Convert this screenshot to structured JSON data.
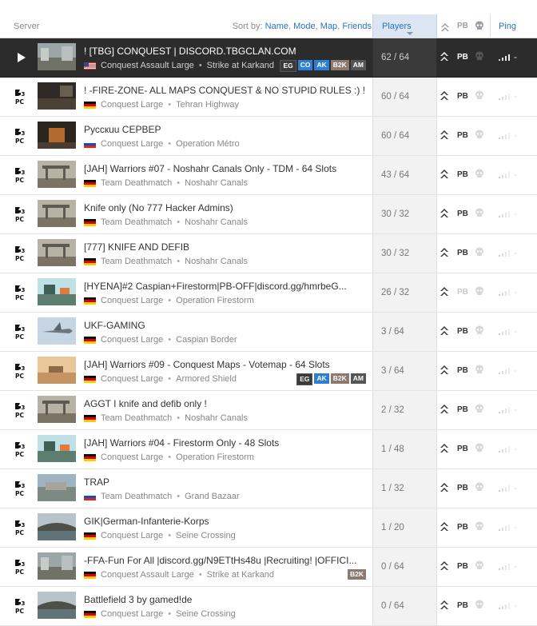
{
  "header": {
    "server_label": "Server",
    "sort_by_label": "Sort by:",
    "sort_options": [
      "Name",
      "Mode",
      "Map",
      "Friends"
    ],
    "players_label": "Players",
    "pb_label": "PB",
    "ping_label": "Ping"
  },
  "rows": [
    {
      "name": "! [TBG] CONQUEST | DISCORD.TBGCLAN.COM",
      "flag": "us",
      "mode": "Conquest Assault Large",
      "map": "Strike at Karkand",
      "players": "62 / 64",
      "tags": [
        "EG",
        "CO",
        "AK",
        "B2K",
        "AM"
      ],
      "pb": true,
      "selected": true,
      "thumb": "city"
    },
    {
      "name": "! -FIRE-ZONE- ALL MAPS CONQUEST & NO STUPID RULES :) !",
      "flag": "de",
      "mode": "Conquest Large",
      "map": "Tehran Highway",
      "players": "60 / 64",
      "tags": [],
      "pb": true,
      "selected": false,
      "thumb": "dark"
    },
    {
      "name": "Русскuu CEPBEP",
      "flag": "ru",
      "mode": "Conquest Large",
      "map": "Operation Métro",
      "players": "60 / 64",
      "tags": [],
      "pb": true,
      "selected": false,
      "thumb": "metro"
    },
    {
      "name": "[JAH] Warriors #07 - Noshahr Canals Only - TDM - 64 Slots",
      "flag": "de",
      "mode": "Team Deathmatch",
      "map": "Noshahr Canals",
      "players": "43 / 64",
      "tags": [],
      "pb": true,
      "selected": false,
      "thumb": "canals"
    },
    {
      "name": "Knife only (No 777 Hacker Admins)",
      "flag": "de",
      "mode": "Team Deathmatch",
      "map": "Noshahr Canals",
      "players": "30 / 32",
      "tags": [],
      "pb": true,
      "selected": false,
      "thumb": "canals"
    },
    {
      "name": "[777] KNIFE AND DEFIB",
      "flag": "de",
      "mode": "Team Deathmatch",
      "map": "Noshahr Canals",
      "players": "30 / 32",
      "tags": [],
      "pb": true,
      "selected": false,
      "thumb": "canals"
    },
    {
      "name": "[HYENA]#2 Caspian+Firestorm|PB-OFF|discord.gg/hmrbeG...",
      "flag": "de",
      "mode": "Conquest Large",
      "map": "Operation Firestorm",
      "players": "26 / 32",
      "tags": [],
      "pb": false,
      "selected": false,
      "thumb": "firestorm"
    },
    {
      "name": "UKF-GAMING",
      "flag": "de",
      "mode": "Conquest Large",
      "map": "Caspian Border",
      "players": "3 / 64",
      "tags": [],
      "pb": true,
      "selected": false,
      "thumb": "jet"
    },
    {
      "name": "[JAH] Warriors #09 - Conquest Maps - Votemap - 64 Slots",
      "flag": "de",
      "mode": "Conquest Large",
      "map": "Armored Shield",
      "players": "3 / 64",
      "tags": [
        "EG",
        "AK",
        "B2K",
        "AM"
      ],
      "pb": true,
      "selected": false,
      "thumb": "desert"
    },
    {
      "name": "AGGT I knife and defib only !",
      "flag": "de",
      "mode": "Team Deathmatch",
      "map": "Noshahr Canals",
      "players": "2 / 32",
      "tags": [],
      "pb": true,
      "selected": false,
      "thumb": "canals"
    },
    {
      "name": "[JAH] Warriors #04 - Firestorm Only - 48 Slots",
      "flag": "de",
      "mode": "Conquest Large",
      "map": "Operation Firestorm",
      "players": "1 / 48",
      "tags": [],
      "pb": true,
      "selected": false,
      "thumb": "firestorm"
    },
    {
      "name": "TRAP",
      "flag": "ru",
      "mode": "Team Deathmatch",
      "map": "Grand Bazaar",
      "players": "1 / 32",
      "tags": [],
      "pb": true,
      "selected": false,
      "thumb": "bazaar"
    },
    {
      "name": "GIK|German-Infanterie-Korps",
      "flag": "de",
      "mode": "Conquest Large",
      "map": "Seine Crossing",
      "players": "1 / 20",
      "tags": [],
      "pb": true,
      "selected": false,
      "thumb": "seine"
    },
    {
      "name": "-FFA-Fun For All |discord.gg/N9ETtHs48u |Recruiting! |OFFICI...",
      "flag": "de",
      "mode": "Conquest Assault Large",
      "map": "Strike at Karkand",
      "players": "0 / 64",
      "tags": [
        "B2K"
      ],
      "pb": true,
      "selected": false,
      "thumb": "city"
    },
    {
      "name": "Battlefield 3 by gamed!de",
      "flag": "de",
      "mode": "Conquest Large",
      "map": "Seine Crossing",
      "players": "0 / 64",
      "tags": [],
      "pb": true,
      "selected": false,
      "thumb": "seine"
    }
  ],
  "colors": {
    "accent": "#2a73c5",
    "selected_bg": "#2c2c2c",
    "players_col": "#dbe6f2"
  },
  "icons": {
    "platform": "bf3-pc-icon",
    "rank": "rank-chevron-icon",
    "skull": "skull-icon",
    "ping": "ping-bars-icon",
    "play": "play-icon"
  }
}
